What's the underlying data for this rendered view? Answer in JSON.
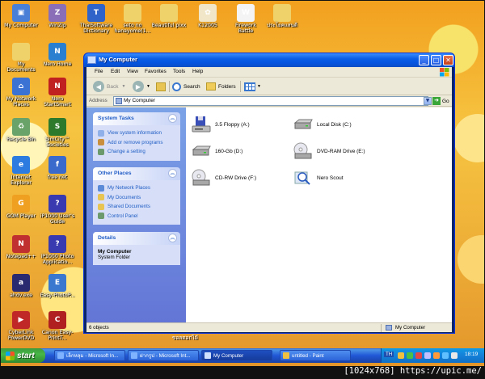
{
  "desktop_icons": [
    {
      "label": "My Computer",
      "color": "#4a7fd8",
      "glyph": "▣"
    },
    {
      "label": "WinZip",
      "color": "#8a6fb8",
      "glyph": "Z"
    },
    {
      "label": "ThaiSoftware Dictionary",
      "color": "#2f63c9",
      "glyph": "T"
    },
    {
      "label": "seto no hanayome(1...",
      "color": "#f0d26a",
      "glyph": ""
    },
    {
      "label": "Beautiful pixx",
      "color": "#f0d26a",
      "glyph": ""
    },
    {
      "label": "K12005",
      "color": "#f1e6c8",
      "glyph": "✿"
    },
    {
      "label": "Firework Battle",
      "color": "#f4f4f4",
      "glyph": "W"
    },
    {
      "label": "ประโยคแสนดี",
      "color": "#f0d26a",
      "glyph": ""
    },
    {
      "label": "My Documents",
      "color": "#f0d26a",
      "glyph": ""
    },
    {
      "label": "Nero Home",
      "color": "#2a7fd0",
      "glyph": "N"
    },
    {
      "label": "My Network Places",
      "color": "#3b73d4",
      "glyph": "⌂"
    },
    {
      "label": "Nero StartSmart",
      "color": "#c02020",
      "glyph": "N"
    },
    {
      "label": "Recycle Bin",
      "color": "#6aa36a",
      "glyph": "♻"
    },
    {
      "label": "SimCity™ Societies",
      "color": "#2d7a2d",
      "glyph": "S"
    },
    {
      "label": "Internet Explorer",
      "color": "#2b7be0",
      "glyph": "e"
    },
    {
      "label": "free net",
      "color": "#3a6acc",
      "glyph": "f"
    },
    {
      "label": "GOM Player",
      "color": "#f0a020",
      "glyph": "G"
    },
    {
      "label": "iP1000 User's Guide",
      "color": "#3a3ab0",
      "glyph": "?"
    },
    {
      "label": "Notepad++",
      "color": "#c03030",
      "glyph": "N"
    },
    {
      "label": "iP1000 Photo Applicatio...",
      "color": "#3a3ab0",
      "glyph": "?"
    },
    {
      "label": "ahdv.exe",
      "color": "#2a2a70",
      "glyph": "a"
    },
    {
      "label": "Easy-PhotoP...",
      "color": "#3a78d0",
      "glyph": "E"
    },
    {
      "label": "CyberLink PowerDVD",
      "color": "#c02828",
      "glyph": "▶"
    },
    {
      "label": "Canon Easy-PrintT...",
      "color": "#b02020",
      "glyph": "C"
    }
  ],
  "window": {
    "title": "My Computer",
    "controls": {
      "minimize": "_",
      "maximize": "□",
      "close": "✕"
    },
    "menu": [
      "File",
      "Edit",
      "View",
      "Favorites",
      "Tools",
      "Help"
    ],
    "toolbar": {
      "back": "Back",
      "search": "Search",
      "folders": "Folders"
    },
    "address": {
      "label": "Address",
      "value": "My Computer",
      "go": "Go"
    },
    "panels": {
      "system_tasks": {
        "title": "System Tasks",
        "items": [
          "View system information",
          "Add or remove programs",
          "Change a setting"
        ]
      },
      "other_places": {
        "title": "Other Places",
        "items": [
          "My Network Places",
          "My Documents",
          "Shared Documents",
          "Control Panel"
        ]
      },
      "details": {
        "title": "Details",
        "name": "My Computer",
        "sub": "System Folder"
      }
    },
    "drives": [
      {
        "name": "3.5 Floppy (A:)",
        "icon": "floppy-icon"
      },
      {
        "name": "Local Disk (C:)",
        "icon": "hard-disk-icon"
      },
      {
        "name": "160-Gb (D:)",
        "icon": "hard-disk-icon"
      },
      {
        "name": "DVD-RAM Drive (E:)",
        "icon": "dvd-drive-icon"
      },
      {
        "name": "CD-RW Drive (F:)",
        "icon": "cd-drive-icon"
      },
      {
        "name": "Nero Scout",
        "icon": "nero-scout-icon"
      }
    ],
    "status": {
      "left": "6 objects",
      "right": "My Computer"
    }
  },
  "taskbar": {
    "start": "start",
    "tasks": [
      "เล็กหลุม - Microsoft In...",
      "ฝากรูป - Microsoft Int...",
      "My Computer",
      "untitled - Paint"
    ],
    "lang": "TH",
    "clock": "18:19"
  },
  "desktop_overlay_text": {
    "thai_label_a": "ขอลดอกไม้",
    "thai_label_b": "แ"
  },
  "watermark": "[1024x768] https://upic.me/",
  "colors": {
    "taskbar_blue": "#2157d7",
    "start_green": "#47b747",
    "titlebar_blue": "#0554e0",
    "link_blue": "#215dc6"
  }
}
